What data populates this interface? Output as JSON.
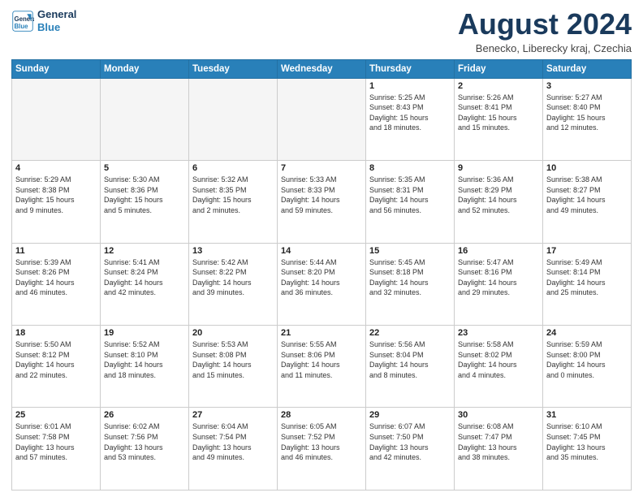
{
  "header": {
    "logo_line1": "General",
    "logo_line2": "Blue",
    "month_title": "August 2024",
    "location": "Benecko, Liberecky kraj, Czechia"
  },
  "days_of_week": [
    "Sunday",
    "Monday",
    "Tuesday",
    "Wednesday",
    "Thursday",
    "Friday",
    "Saturday"
  ],
  "weeks": [
    [
      {
        "num": "",
        "info": ""
      },
      {
        "num": "",
        "info": ""
      },
      {
        "num": "",
        "info": ""
      },
      {
        "num": "",
        "info": ""
      },
      {
        "num": "1",
        "info": "Sunrise: 5:25 AM\nSunset: 8:43 PM\nDaylight: 15 hours\nand 18 minutes."
      },
      {
        "num": "2",
        "info": "Sunrise: 5:26 AM\nSunset: 8:41 PM\nDaylight: 15 hours\nand 15 minutes."
      },
      {
        "num": "3",
        "info": "Sunrise: 5:27 AM\nSunset: 8:40 PM\nDaylight: 15 hours\nand 12 minutes."
      }
    ],
    [
      {
        "num": "4",
        "info": "Sunrise: 5:29 AM\nSunset: 8:38 PM\nDaylight: 15 hours\nand 9 minutes."
      },
      {
        "num": "5",
        "info": "Sunrise: 5:30 AM\nSunset: 8:36 PM\nDaylight: 15 hours\nand 5 minutes."
      },
      {
        "num": "6",
        "info": "Sunrise: 5:32 AM\nSunset: 8:35 PM\nDaylight: 15 hours\nand 2 minutes."
      },
      {
        "num": "7",
        "info": "Sunrise: 5:33 AM\nSunset: 8:33 PM\nDaylight: 14 hours\nand 59 minutes."
      },
      {
        "num": "8",
        "info": "Sunrise: 5:35 AM\nSunset: 8:31 PM\nDaylight: 14 hours\nand 56 minutes."
      },
      {
        "num": "9",
        "info": "Sunrise: 5:36 AM\nSunset: 8:29 PM\nDaylight: 14 hours\nand 52 minutes."
      },
      {
        "num": "10",
        "info": "Sunrise: 5:38 AM\nSunset: 8:27 PM\nDaylight: 14 hours\nand 49 minutes."
      }
    ],
    [
      {
        "num": "11",
        "info": "Sunrise: 5:39 AM\nSunset: 8:26 PM\nDaylight: 14 hours\nand 46 minutes."
      },
      {
        "num": "12",
        "info": "Sunrise: 5:41 AM\nSunset: 8:24 PM\nDaylight: 14 hours\nand 42 minutes."
      },
      {
        "num": "13",
        "info": "Sunrise: 5:42 AM\nSunset: 8:22 PM\nDaylight: 14 hours\nand 39 minutes."
      },
      {
        "num": "14",
        "info": "Sunrise: 5:44 AM\nSunset: 8:20 PM\nDaylight: 14 hours\nand 36 minutes."
      },
      {
        "num": "15",
        "info": "Sunrise: 5:45 AM\nSunset: 8:18 PM\nDaylight: 14 hours\nand 32 minutes."
      },
      {
        "num": "16",
        "info": "Sunrise: 5:47 AM\nSunset: 8:16 PM\nDaylight: 14 hours\nand 29 minutes."
      },
      {
        "num": "17",
        "info": "Sunrise: 5:49 AM\nSunset: 8:14 PM\nDaylight: 14 hours\nand 25 minutes."
      }
    ],
    [
      {
        "num": "18",
        "info": "Sunrise: 5:50 AM\nSunset: 8:12 PM\nDaylight: 14 hours\nand 22 minutes."
      },
      {
        "num": "19",
        "info": "Sunrise: 5:52 AM\nSunset: 8:10 PM\nDaylight: 14 hours\nand 18 minutes."
      },
      {
        "num": "20",
        "info": "Sunrise: 5:53 AM\nSunset: 8:08 PM\nDaylight: 14 hours\nand 15 minutes."
      },
      {
        "num": "21",
        "info": "Sunrise: 5:55 AM\nSunset: 8:06 PM\nDaylight: 14 hours\nand 11 minutes."
      },
      {
        "num": "22",
        "info": "Sunrise: 5:56 AM\nSunset: 8:04 PM\nDaylight: 14 hours\nand 8 minutes."
      },
      {
        "num": "23",
        "info": "Sunrise: 5:58 AM\nSunset: 8:02 PM\nDaylight: 14 hours\nand 4 minutes."
      },
      {
        "num": "24",
        "info": "Sunrise: 5:59 AM\nSunset: 8:00 PM\nDaylight: 14 hours\nand 0 minutes."
      }
    ],
    [
      {
        "num": "25",
        "info": "Sunrise: 6:01 AM\nSunset: 7:58 PM\nDaylight: 13 hours\nand 57 minutes."
      },
      {
        "num": "26",
        "info": "Sunrise: 6:02 AM\nSunset: 7:56 PM\nDaylight: 13 hours\nand 53 minutes."
      },
      {
        "num": "27",
        "info": "Sunrise: 6:04 AM\nSunset: 7:54 PM\nDaylight: 13 hours\nand 49 minutes."
      },
      {
        "num": "28",
        "info": "Sunrise: 6:05 AM\nSunset: 7:52 PM\nDaylight: 13 hours\nand 46 minutes."
      },
      {
        "num": "29",
        "info": "Sunrise: 6:07 AM\nSunset: 7:50 PM\nDaylight: 13 hours\nand 42 minutes."
      },
      {
        "num": "30",
        "info": "Sunrise: 6:08 AM\nSunset: 7:47 PM\nDaylight: 13 hours\nand 38 minutes."
      },
      {
        "num": "31",
        "info": "Sunrise: 6:10 AM\nSunset: 7:45 PM\nDaylight: 13 hours\nand 35 minutes."
      }
    ]
  ]
}
